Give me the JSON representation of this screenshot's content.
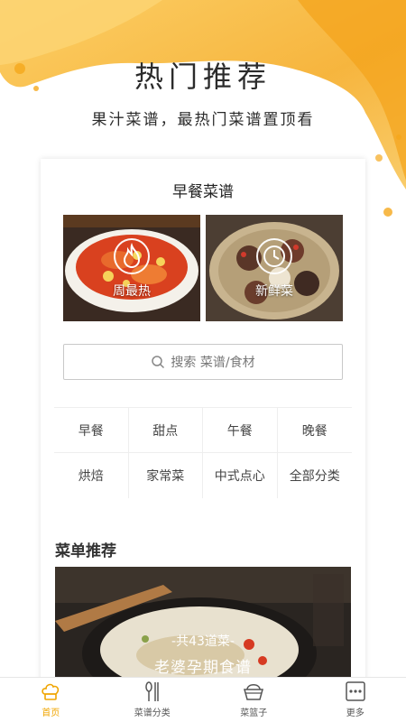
{
  "hero": {
    "title": "热门推荐",
    "subtitle": "果汁菜谱，最热门菜谱置顶看"
  },
  "card": {
    "title": "早餐菜谱",
    "features": [
      {
        "label": "周最热",
        "icon": "flame-icon"
      },
      {
        "label": "新鲜菜",
        "icon": "clock-icon"
      }
    ],
    "search": {
      "placeholder": "搜索 菜谱/食材",
      "icon": "search-icon"
    },
    "categories": [
      "早餐",
      "甜点",
      "午餐",
      "晚餐",
      "烘焙",
      "家常菜",
      "中式点心",
      "全部分类"
    ],
    "section_title": "菜单推荐",
    "menu": {
      "count": "-共43道菜-",
      "name": "老婆孕期食谱"
    }
  },
  "tabbar": {
    "items": [
      {
        "label": "首页",
        "icon": "chef-hat-icon",
        "active": true
      },
      {
        "label": "菜谱分类",
        "icon": "utensils-icon",
        "active": false
      },
      {
        "label": "菜篮子",
        "icon": "basket-icon",
        "active": false
      },
      {
        "label": "更多",
        "icon": "more-icon",
        "active": false
      }
    ]
  },
  "colors": {
    "accent": "#f0a500",
    "splash": "#f7b52a"
  }
}
